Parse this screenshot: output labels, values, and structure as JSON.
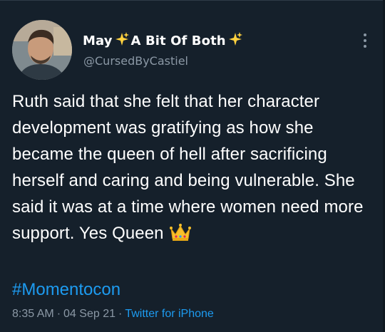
{
  "author": {
    "display_name_prefix": "May",
    "display_name_middle": "A Bit Of Both",
    "handle": "@CursedByCastiel",
    "sparkle_icon": "sparkles-emoji",
    "avatar": "profile-photo"
  },
  "tweet": {
    "text": "Ruth said that she felt that her character development was gratifying as how she became the queen of hell after sacrificing herself and caring and being vulnerable. She said it was at a time where women need more support. Yes Queen",
    "emoji": "crown-emoji",
    "hashtag": "#Momentocon"
  },
  "meta": {
    "time": "8:35 AM",
    "separator": "·",
    "date": "04 Sep 21",
    "source": "Twitter for iPhone"
  },
  "colors": {
    "background": "#15202b",
    "text": "#ffffff",
    "secondary": "#8b98a5",
    "link": "#1d9bf0",
    "sparkle": "#ffd23f"
  }
}
